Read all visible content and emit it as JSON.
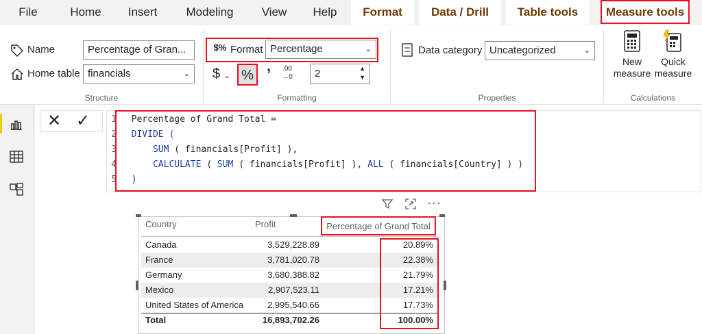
{
  "tabs": [
    "File",
    "Home",
    "Insert",
    "Modeling",
    "View",
    "Help",
    "Format",
    "Data / Drill",
    "Table tools",
    "Measure tools"
  ],
  "structure": {
    "name_label": "Name",
    "name_value": "Percentage of Gran...",
    "home_table_label": "Home table",
    "home_table_value": "financials",
    "group_label": "Structure"
  },
  "formatting": {
    "format_label": "Format",
    "format_value": "Percentage",
    "decimals_value": "2",
    "group_label": "Formatting"
  },
  "properties": {
    "data_category_label": "Data category",
    "data_category_value": "Uncategorized",
    "group_label": "Properties"
  },
  "calculations": {
    "new_measure_line1": "New",
    "new_measure_line2": "measure",
    "quick_measure_line1": "Quick",
    "quick_measure_line2": "measure",
    "group_label": "Calculations"
  },
  "formula": {
    "line_numbers": [
      "1",
      "2",
      "3",
      "4",
      "5"
    ],
    "line1": "Percentage of Grand Total =",
    "line2_kw": "DIVIDE (",
    "line3_kw": "SUM",
    "line3_rest": " ( financials[Profit] ),",
    "line4_kw1": "CALCULATE",
    "line4_mid1": " ( ",
    "line4_kw2": "SUM",
    "line4_mid2": " ( financials[Profit] ), ",
    "line4_kw3": "ALL",
    "line4_rest": " ( financials[Country] ) )",
    "line5": ")"
  },
  "table": {
    "headers": [
      "Country",
      "Profit",
      "Percentage of Grand Total"
    ],
    "rows": [
      {
        "country": "Canada",
        "profit": "3,529,228.89",
        "pct": "20.89%"
      },
      {
        "country": "France",
        "profit": "3,781,020.78",
        "pct": "22.38%"
      },
      {
        "country": "Germany",
        "profit": "3,680,388.82",
        "pct": "21.79%"
      },
      {
        "country": "Mexico",
        "profit": "2,907,523.11",
        "pct": "17.21%"
      },
      {
        "country": "United States of America",
        "profit": "2,995,540.66",
        "pct": "17.73%"
      }
    ],
    "total": {
      "label": "Total",
      "profit": "16,893,702.26",
      "pct": "100.00%"
    }
  },
  "icons": {
    "filter": "filter-icon",
    "focus": "focus-mode-icon",
    "more": "more-options-icon"
  },
  "colors": {
    "accent_red": "#e81123",
    "context_tab_text": "#6f3800",
    "keyword_blue": "#1f3ba8",
    "rail_active": "#f2c811"
  }
}
